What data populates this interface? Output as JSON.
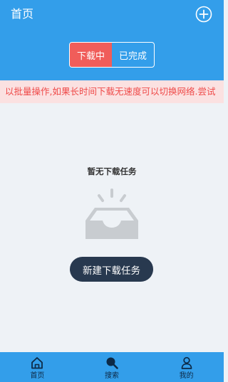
{
  "header": {
    "title": "首页",
    "add_icon": "plus-circle-icon"
  },
  "segments": [
    {
      "label": "下载中",
      "active": true
    },
    {
      "label": "已完成",
      "active": false
    }
  ],
  "notice": {
    "text": "以批量操作,如果长时间下载无速度可以切换网络.尝试"
  },
  "empty_state": {
    "message": "暂无下载任务",
    "illustration": "empty-inbox-icon",
    "button_label": "新建下载任务"
  },
  "bottom_nav": [
    {
      "label": "首页",
      "icon": "home-icon",
      "active": true
    },
    {
      "label": "搜索",
      "icon": "search-icon",
      "active": false
    },
    {
      "label": "我的",
      "icon": "profile-icon",
      "active": false
    }
  ],
  "colors": {
    "primary": "#339eea",
    "accent": "#f05d5a",
    "notice_bg": "#fbe1e1",
    "notice_text": "#ef4a49",
    "button_dark": "#28394f",
    "nav_active": "#0d2a47",
    "nav_inactive": "#ffffff"
  }
}
